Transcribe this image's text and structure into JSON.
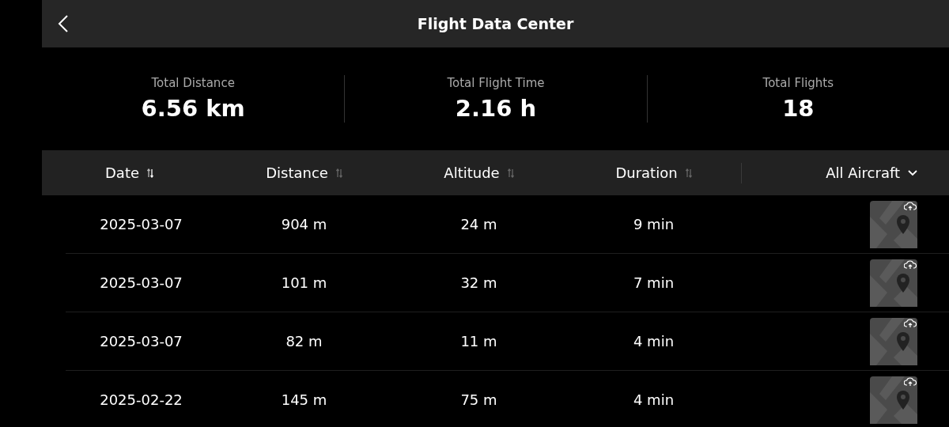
{
  "header": {
    "title": "Flight Data Center"
  },
  "stats": [
    {
      "label": "Total Distance",
      "value": "6.56 km"
    },
    {
      "label": "Total Flight Time",
      "value": "2.16 h"
    },
    {
      "label": "Total Flights",
      "value": "18"
    }
  ],
  "columns": [
    {
      "label": "Date",
      "selected": true
    },
    {
      "label": "Distance",
      "selected": false
    },
    {
      "label": "Altitude",
      "selected": false
    },
    {
      "label": "Duration",
      "selected": false
    }
  ],
  "aircraft_filter": "All Aircraft",
  "rows": [
    {
      "date": "2025-03-07",
      "distance": "904 m",
      "altitude": "24 m",
      "duration": "9 min"
    },
    {
      "date": "2025-03-07",
      "distance": "101 m",
      "altitude": "32 m",
      "duration": "7 min"
    },
    {
      "date": "2025-03-07",
      "distance": "82 m",
      "altitude": "11 m",
      "duration": "4 min"
    },
    {
      "date": "2025-02-22",
      "distance": "145 m",
      "altitude": "75 m",
      "duration": "4 min"
    }
  ]
}
